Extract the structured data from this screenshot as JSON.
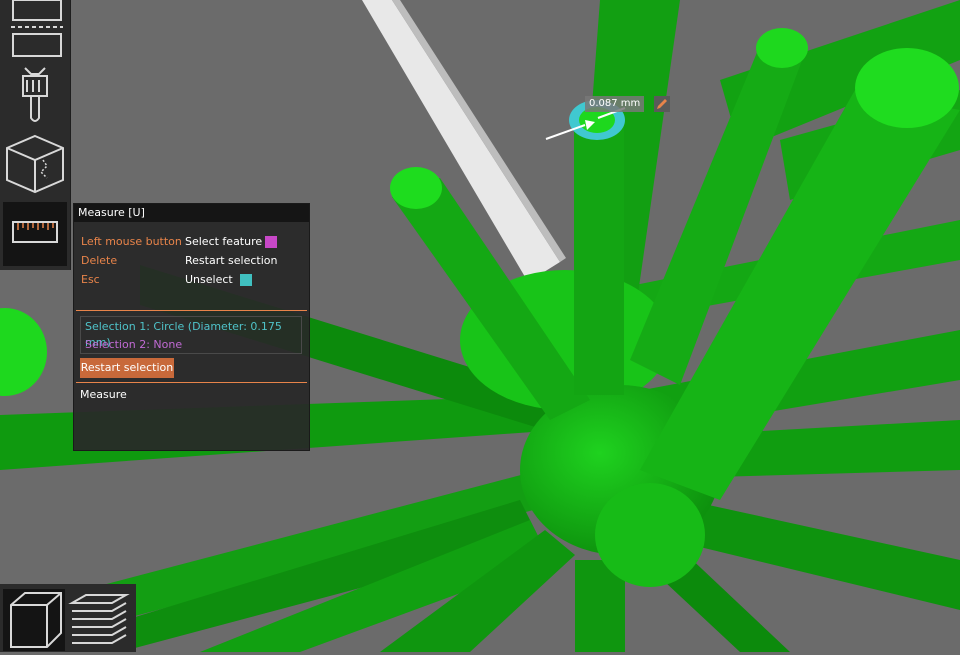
{
  "toolbar": {
    "tools": [
      {
        "name": "cut-tool",
        "label": "Cut"
      },
      {
        "name": "paint-tool",
        "label": "Paint"
      },
      {
        "name": "seam-tool",
        "label": "Seam"
      },
      {
        "name": "measure-tool",
        "label": "Measure",
        "active": true
      }
    ]
  },
  "measure": {
    "title": "Measure [U]",
    "shortcuts": [
      {
        "key": "Left mouse button",
        "desc": "Select feature",
        "swatch": "#c848c8"
      },
      {
        "key": "Delete",
        "desc": "Restart selection"
      },
      {
        "key": "Esc",
        "desc": "Unselect",
        "swatch": "#40c0c0"
      }
    ],
    "selection1": "Selection 1:   Circle (Diameter: 0.175 mm)",
    "selection2": "Selection 2:   None",
    "restart_label": "Restart selection",
    "section_label": "Measure"
  },
  "scene": {
    "distance": "0.087 mm",
    "model_color": "#1ed81e",
    "background": "#6b6b6b"
  },
  "view": {
    "buttons": [
      "3d-view",
      "preview-view"
    ]
  },
  "colors": {
    "accent": "#e8844a",
    "selection1": "#4fc3c9",
    "selection2": "#c06ad4"
  }
}
